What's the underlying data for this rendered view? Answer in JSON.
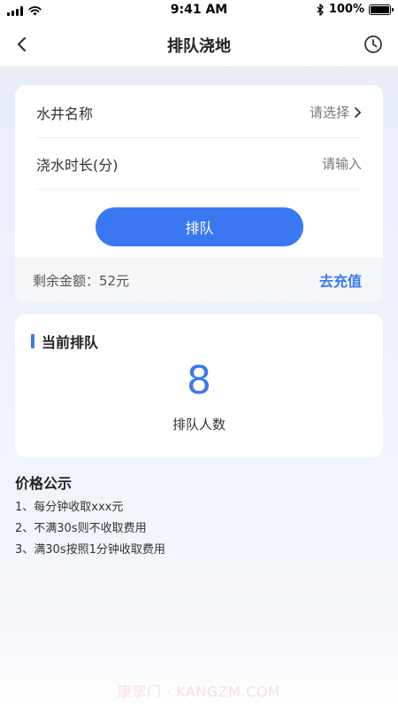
{
  "status_bar": {
    "time": "9:41 AM",
    "battery": "100%"
  },
  "nav": {
    "title": "排队浇地",
    "back_icon": "chevron-left-icon",
    "history_icon": "clock-icon"
  },
  "form": {
    "well_label": "水井名称",
    "well_value": "请选择",
    "duration_label": "浇水时长(分)",
    "duration_placeholder": "请输入",
    "queue_button": "排队",
    "balance_text": "剩余金额：52元",
    "recharge_link": "去充值"
  },
  "queue": {
    "title": "当前排队",
    "count": "8",
    "count_label": "排队人数"
  },
  "price": {
    "title": "价格公示",
    "items": [
      "1、每分钟收取xxx元",
      "2、不满30s则不收取费用",
      "3、满30s按照1分钟收取费用"
    ]
  },
  "watermark": "康掌门 · KANGZM.COM",
  "colors": {
    "accent": "#3a78f2",
    "background": "#e9eef9"
  }
}
